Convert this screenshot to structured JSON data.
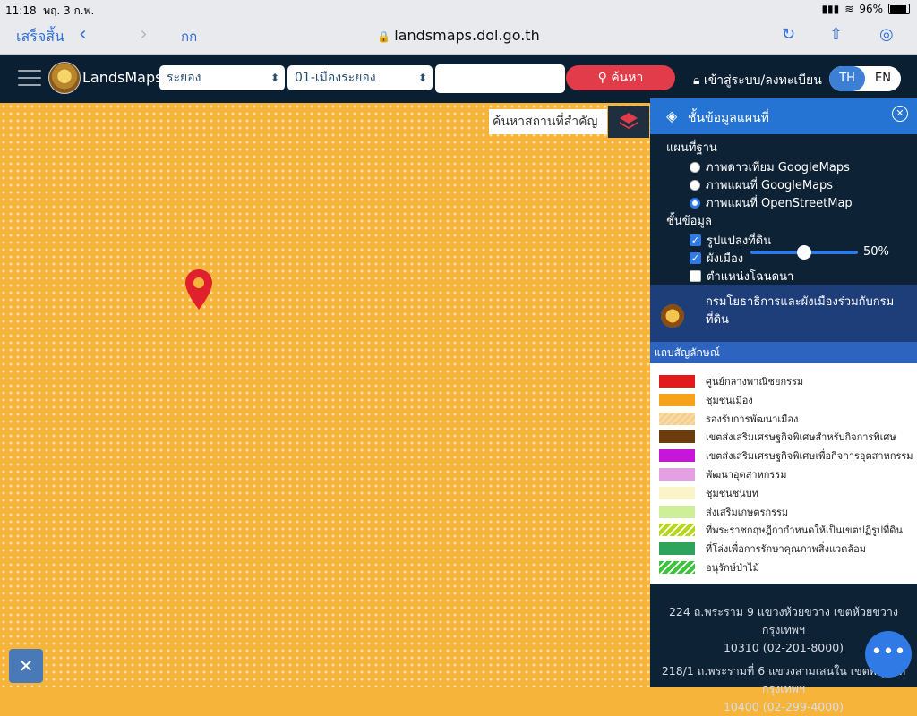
{
  "status": {
    "time": "11:18",
    "date": "พฤ. 3 ก.พ.",
    "battery": "96%"
  },
  "safari": {
    "done": "เสร็จสิ้น",
    "aa": "กก",
    "url": "landsmaps.dol.go.th"
  },
  "header": {
    "brand": "LandsMaps",
    "province": "ระยอง",
    "district": "01-เมืองระยอง",
    "search_value": "",
    "search_button": "ค้นหา",
    "login": "เข้าสู่ระบบ/ลงทะเบียน",
    "lang_th": "TH",
    "lang_en": "EN"
  },
  "map": {
    "place_search": "ค้นหาสถานที่สำคัญ"
  },
  "panel": {
    "title": "ชั้นข้อมูลแผนที่",
    "basemap_label": "แผนที่ฐาน",
    "basemaps": [
      "ภาพดาวเทียม GoogleMaps",
      "ภาพแผนที่ GoogleMaps",
      "ภาพแผนที่ OpenStreetMap"
    ],
    "basemap_selected": 2,
    "layers_label": "ชั้นข้อมูล",
    "layers": [
      "รูปแปลงที่ดิน",
      "ผังเมือง",
      "ตำแหน่งโฉนดนา"
    ],
    "opacity": "50%",
    "opacity_fraction": 0.5,
    "agency": "กรมโยธาธิการและผังเมืองร่วมกับกรมที่ดิน",
    "legend_title": "แถบสัญลักษณ์",
    "legend": [
      {
        "label": "ศูนย์กลางพาณิชยกรรม",
        "color": "#e31a1c"
      },
      {
        "label": "ชุมชนเมือง",
        "color": "#f7a21b"
      },
      {
        "label": "รองรับการพัฒนาเมือง",
        "color": "#f5cf8c"
      },
      {
        "label": "เขตส่งเสริมเศรษฐกิจพิเศษสำหรับกิจการพิเศษ",
        "color": "#6b3d0e"
      },
      {
        "label": "เขตส่งเสริมเศรษฐกิจพิเศษเพื่อกิจการอุตสาหกรรม",
        "color": "#c517d8"
      },
      {
        "label": "พัฒนาอุตสาหกรรม",
        "color": "#e3a0e3"
      },
      {
        "label": "ชุมชนชนบท",
        "color": "#fbf4c8"
      },
      {
        "label": "ส่งเสริมเกษตรกรรม",
        "color": "#cfee9a"
      },
      {
        "label": "ที่พระราชกฤษฎีกากำหนดให้เป็นเขตปฏิรูปที่ดิน",
        "color": "#b9d61f"
      },
      {
        "label": "ที่โล่งเพื่อการรักษาคุณภาพสิ่งแวดล้อม",
        "color": "#2ea35b"
      },
      {
        "label": "อนุรักษ์ป่าไม้",
        "color": "#3ec43c"
      }
    ],
    "address1_line1": "224 ถ.พระราม 9 แขวงห้วยขวาง เขตห้วยขวาง กรุงเทพฯ",
    "address1_line2": "10310 (02-201-8000)",
    "address2_line1": "218/1 ถ.พระรามที่ 6 แขวงสามเสนใน เขตพญาไท กรุงเทพฯ",
    "address2_line2": "10400 (02-299-4000)"
  }
}
